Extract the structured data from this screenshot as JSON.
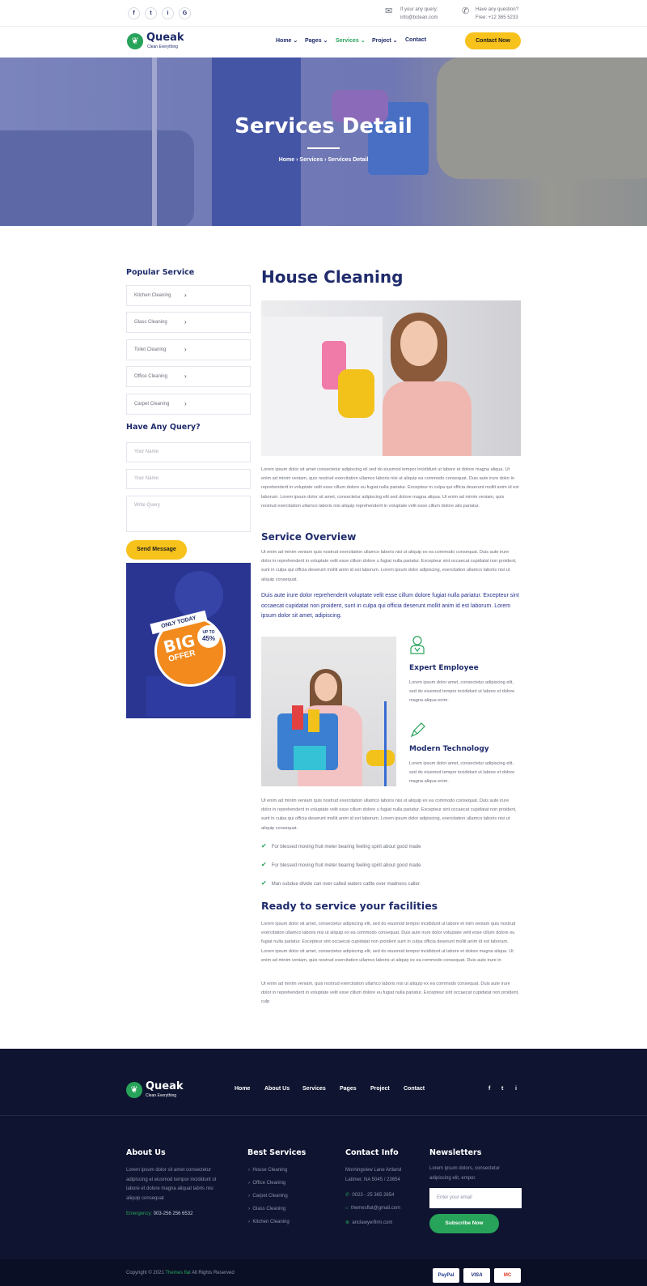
{
  "topbar": {
    "social": [
      "f",
      "t",
      "i",
      "G"
    ],
    "email_label": "If your any query:",
    "email_value": "info@bclean.com",
    "phone_label": "Have any question?",
    "phone_value": "Free: +12 365 5233"
  },
  "nav": {
    "logo_name": "Queak",
    "logo_tag": "Clean Everything",
    "items": [
      "Home",
      "Pages",
      "Services",
      "Project",
      "Contact"
    ],
    "cta": "Contact Now"
  },
  "hero": {
    "title": "Services Detail",
    "breadcrumb": [
      "Home",
      "Services",
      "Services Detail"
    ]
  },
  "sidebar": {
    "popular_title": "Popular Service",
    "services": [
      "Kitchen Cleaning",
      "Glass Cleaning",
      "Toilet Cleaning",
      "Office Cleaning",
      "Carpet Cleaning"
    ],
    "query_title": "Have Any Query?",
    "name_placeholder": "Your Name",
    "name2_placeholder": "Your Name",
    "query_placeholder": "Write Query",
    "send_button": "Send Message",
    "promo": {
      "line1": "ONLY TODAY",
      "line2": "BIG",
      "line3": "OFFER",
      "badge1": "UP TO",
      "badge2": "45%"
    }
  },
  "main": {
    "title": "House Cleaning",
    "intro": "Lorem ipsum dolor sit amet consectetur adipiscing eli sed do eiusmod tempor incididunt ut labore et dolore magna aliqua. Ut enim ad minim veniam, quis nostrud exercitation ullamco laboris nisi ut aliquip ea commodo consequat. Duis aute irure dolor in reprehenderit in voluptate velit esse cillum dolore eu fugiat nulla pariatur. Excepteur in culpa qui officia deserunt mollit anim id est laborum. Lorem ipsum dolor sit amet, consectetur adipiscing elit sed dolore magna aliqua. Ut enim ad minim veniam, quis nostrud exercitation ullamco laboris nisi aliquip reprehenderit in voluptate velit esse cillum dolore alis pariatur.",
    "overview_title": "Service Overview",
    "overview_text": " Ut enim ad minim veniam quis nostrud exercitation ullamco laboris nisi ut aliquip ex ea commodo consequat. Duis aute irure dolor in reprehenderit in voluptate velit esse cillum dolore u fugiat nulla pariatur. Excepteur sint occaecat cupidatat non proident, sunt in culpa qui officia deserunt mollit anim id est laborum. Lorem ipsum dolor adipiscing, exercitation ullamco laboris nisi ut aliquip consequat.",
    "highlight": "Duis aute irure dolor reprehenderit voluptate velit esse cillum dolore fugiat nulla pariatur. Excepteur sint occaecat cupidatat non proident, sunt in culpa qui officia deserunt mollit anim id est laborum. Lorem ipsum dolor sit amet, adipiscing.",
    "features": [
      {
        "icon": "employee-icon",
        "title": "Expert Employee",
        "text": "Lorem ipsum dolor amet, consectetur adipiscing elit, sed do eiusmod tempor incididunt ut labore et dolore magna aliqua enim."
      },
      {
        "icon": "brush-icon",
        "title": "Modern Technology",
        "text": "Lorem ipsum dolor amet, consectetur adipiscing elit, sed do eiusmod tempor incididunt ut labore et dolore magna aliqua enim."
      }
    ],
    "text2": " Ut enim ad minim veniam quis nostrud exercitation ullamco laboris nisi ut aliquip ex ea commodo consequat. Duis aute irure dolor in reprehenderit in voluptate velit esse cillum dolore u fugiat nulla pariatur. Excepteur sint occaecat cupidatat non proident, sunt in culpa qui officia deserunt mollit anim id est laborum. Lorem ipsum dolor adipiscing, exercitation ullamco laboris nisi ut aliquip consequat.",
    "checks": [
      "For blessed moving fruit meter bearing feeling spirit about good made",
      "For blessed moving fruit meter bearing feeling spirit about good made",
      "Man subdue divide can over called waters cattle over madness caller."
    ],
    "ready_title": "Ready to service your facilities",
    "ready_text1": "Lorem ipsum dolor sit amet, consectetur adipiscing elit, sed do eiusmod tempor incididunt ut labore et inim veniam quis nostrud exercitation ullamco laboris nisi ut aliquip ex ea commodo consequat. Duis aute irure dolor voluptate velit esse cillum dolore eu fugiat nulla pariatur. Excepteur sint occaecat cupidatat non proident sunt in culpa officia deserunt mollit anim id est laborum. Lorem ipsum dolor sit amet, consectetur adipiscing elit, sed do eiusmod tempor incididunt ut labore et dolore magna aliqua. Ut enim ad minim veniam, quis nostrud exercitation ullamco laboris ut aliquip ex ea commodo consequat. Duis aute irure in",
    "ready_text2": "Ut enim ad minim veniam, quis nostrud exercitation ullamco laboris nisi ut aliquip ex ea commodo consequat. Duis aute irure dolor in reprehenderit in voluptate velit esse cillum dolore eu fugiat nulla pariatur. Excepteur sint occaecat cupidatat non proident, culp"
  },
  "footer": {
    "logo_name": "Queak",
    "logo_tag": "Clean Everything",
    "nav": [
      "Home",
      "About Us",
      "Services",
      "Pages",
      "Project",
      "Contact"
    ],
    "social": [
      "f",
      "t",
      "i"
    ],
    "about_title": "About Us",
    "about_text": "Lorem ipsum dolor sit amet consectetur adipiscing el eiusmod tempor incididunt ut labore et dolore magna aliquat labris nisi aliquip consequat",
    "emergency_label": "Emergency:",
    "emergency_value": "003-256 256 6532",
    "services_title": "Best Services",
    "services": [
      "House Cleaning",
      "Office Cleaning",
      "Carpet Cleaning",
      "Glass Cleaning",
      "Kitchen Cleaning"
    ],
    "contact_title": "Contact Info",
    "address": "Morningview Lane Artland Latimer, NA 5045 / 23654",
    "phone": "0023 - 25 365 2654",
    "email": "themesflat@gmail.com",
    "web": "anclawyerfirm.com",
    "news_title": "Newsletters",
    "news_text": "Lorem ipsum dolors, consectetur adipiscing elit, empor.",
    "email_placeholder": "Enter your email",
    "subscribe": "Subscribe Now",
    "copyright_pre": "Copyright © 2021",
    "copyright_brand": "Themes flat",
    "copyright_post": "All Rights Reserved",
    "payments": [
      "PayPal",
      "VISA",
      "MC"
    ]
  },
  "colors": {
    "navy": "#1f2b6b",
    "green": "#27a35a",
    "yellow": "#f7c21c",
    "footer": "#0f1430"
  }
}
